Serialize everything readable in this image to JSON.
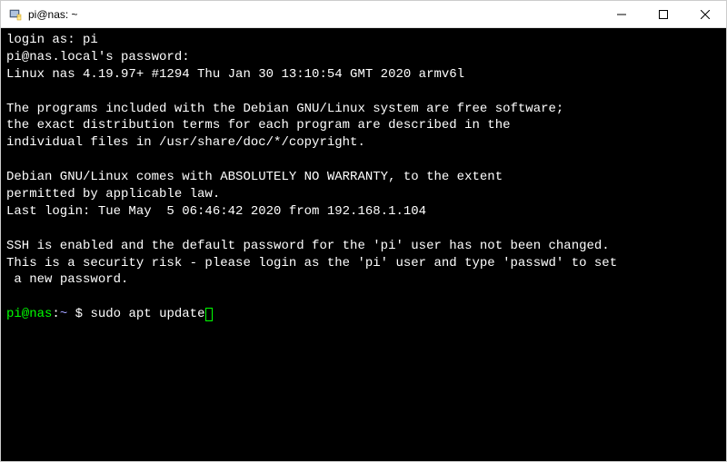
{
  "window": {
    "title": "pi@nas: ~"
  },
  "terminal": {
    "lines": [
      "login as: pi",
      "pi@nas.local's password:",
      "Linux nas 4.19.97+ #1294 Thu Jan 30 13:10:54 GMT 2020 armv6l",
      "",
      "The programs included with the Debian GNU/Linux system are free software;",
      "the exact distribution terms for each program are described in the",
      "individual files in /usr/share/doc/*/copyright.",
      "",
      "Debian GNU/Linux comes with ABSOLUTELY NO WARRANTY, to the extent",
      "permitted by applicable law.",
      "Last login: Tue May  5 06:46:42 2020 from 192.168.1.104",
      "",
      "SSH is enabled and the default password for the 'pi' user has not been changed.",
      "This is a security risk - please login as the 'pi' user and type 'passwd' to set",
      " a new password.",
      ""
    ],
    "prompt": {
      "user": "pi@nas",
      "sep1": ":",
      "path": "~",
      "sep2": " $ ",
      "command": "sudo apt update"
    }
  }
}
